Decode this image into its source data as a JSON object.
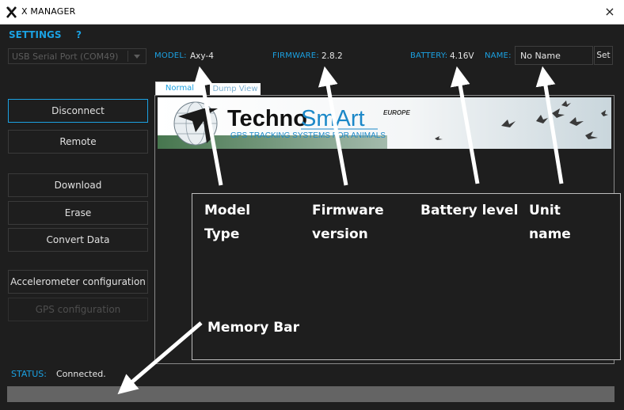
{
  "window": {
    "title": "X MANAGER",
    "logo_letter": "X",
    "close_glyph": "×"
  },
  "header": {
    "settings_label": "SETTINGS",
    "help_label": "?"
  },
  "port_select": {
    "value": "USB Serial Port (COM49)",
    "icon": "chevron-down-icon"
  },
  "device_info": {
    "model_label": "MODEL:",
    "model_value": "Axy-4",
    "firmware_label": "FIRMWARE:",
    "firmware_value": "2.8.2",
    "battery_label": "BATTERY:",
    "battery_value": "4.16V",
    "name_label": "NAME:",
    "name_value": "No Name",
    "set_label": "Set"
  },
  "sidebar": {
    "buttons": [
      {
        "label": "Disconnect",
        "state": "focused"
      },
      {
        "label": "Remote",
        "state": "normal"
      },
      {
        "label": "Download",
        "state": "normal"
      },
      {
        "label": "Erase",
        "state": "normal"
      },
      {
        "label": "Convert Data",
        "state": "normal"
      },
      {
        "label": "Accelerometer configuration",
        "state": "normal"
      },
      {
        "label": "GPS configuration",
        "state": "disabled"
      }
    ]
  },
  "tabs": [
    {
      "label": "Normal View",
      "active": true
    },
    {
      "label": "Dump View",
      "active": false
    }
  ],
  "banner": {
    "brand_part1": "Techno",
    "brand_part2": "SmArt",
    "region": "EUROPE",
    "tagline": "GPS TRACKING SYSTEMS FOR ANIMALS"
  },
  "status": {
    "label": "STATUS:",
    "value": "Connected."
  },
  "memory_bar": {
    "fill_fraction": 0
  },
  "annotations": {
    "model_type": "Model Type",
    "firmware_version": "Firmware version",
    "battery_level": "Battery level",
    "unit_name": "Unit name",
    "memory_bar": "Memory Bar"
  },
  "colors": {
    "accent": "#1ba1e2",
    "background": "#1e1e1e",
    "annotation": "#ffffff"
  }
}
